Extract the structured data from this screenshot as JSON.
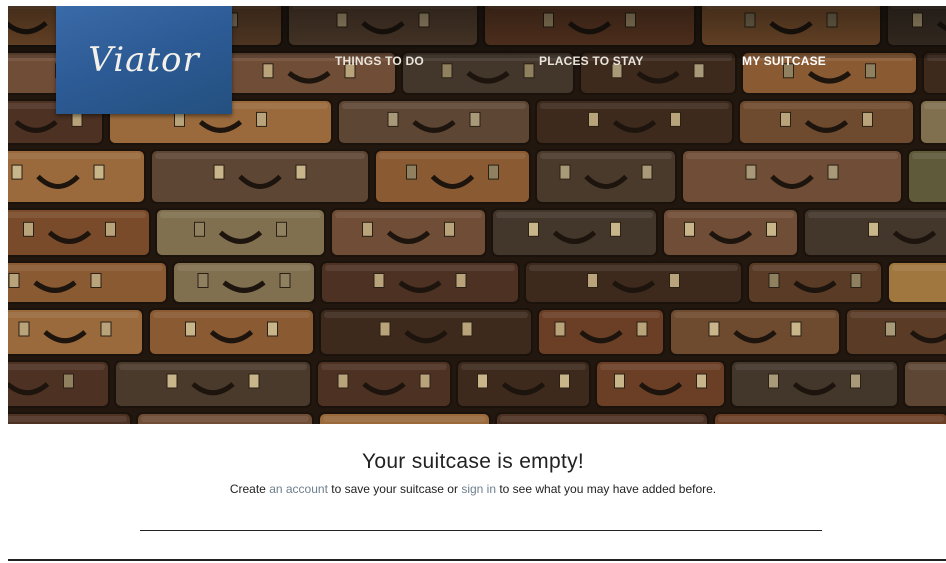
{
  "brand": {
    "logo_text": "Viator",
    "logo_color": "#2f5f9c"
  },
  "nav": {
    "items": [
      {
        "label": "THINGS TO DO",
        "active": false
      },
      {
        "label": "PLACES TO STAY",
        "active": false
      },
      {
        "label": "MY SUITCASE",
        "active": true
      }
    ]
  },
  "hero": {
    "image": "stacked-vintage-suitcases"
  },
  "suitcase": {
    "title": "Your suitcase is empty!",
    "msg_part1": "Create ",
    "account_link": "an account",
    "msg_part2": " to save your suitcase or ",
    "signin_link": "sign in",
    "msg_part3": " to see what you may have added before.",
    "link_color": "#6d7f8c"
  }
}
